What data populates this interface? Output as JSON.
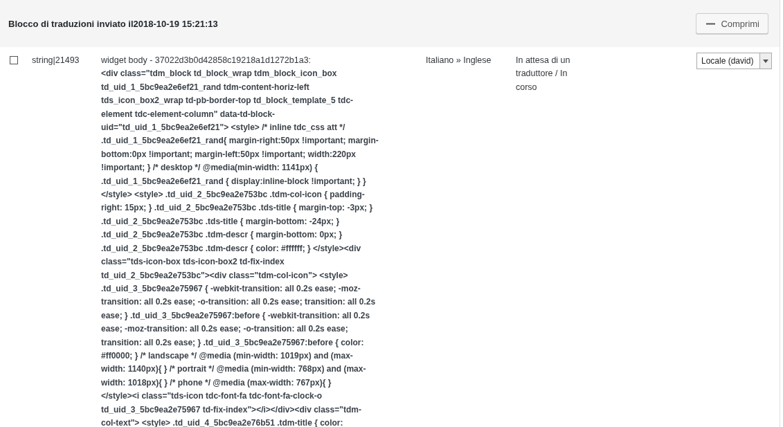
{
  "header": {
    "title": "Blocco di traduzioni inviato il2018-10-19 15:21:13",
    "collapse_button": "Comprimi"
  },
  "rows": [
    {
      "checked": false,
      "id": "string|21493",
      "title": "widget body - 37022d3b0d42858c19218a1d1272b1a3:",
      "code_lines": [
        "<div class=\"tdm_block td_block_wrap tdm_block_icon_box",
        "td_uid_1_5bc9ea2e6ef21_rand tdm-content-horiz-left",
        "tds_icon_box2_wrap td-pb-border-top td_block_template_5 tdc-",
        "element tdc-element-column\" data-td-block-",
        "uid=\"td_uid_1_5bc9ea2e6ef21\"> <style> /* inline tdc_css att */",
        ".td_uid_1_5bc9ea2e6ef21_rand{ margin-right:50px !important; margin-",
        "bottom:0px !important; margin-left:50px !important; width:220px",
        "!important; } /* desktop */ @media(min-width: 1141px) {",
        ".td_uid_1_5bc9ea2e6ef21_rand { display:inline-block !important; } }",
        "</style> <style> .td_uid_2_5bc9ea2e753bc .tdm-col-icon { padding-",
        "right: 15px; } .td_uid_2_5bc9ea2e753bc .tds-title { margin-top: -3px; }",
        ".td_uid_2_5bc9ea2e753bc .tds-title { margin-bottom: -24px; }",
        ".td_uid_2_5bc9ea2e753bc .tdm-descr { margin-bottom: 0px; }",
        ".td_uid_2_5bc9ea2e753bc .tdm-descr { color: #ffffff; } </style><div",
        "class=\"tds-icon-box tds-icon-box2 td-fix-index",
        "td_uid_2_5bc9ea2e753bc\"><div class=\"tdm-col-icon\"> <style>",
        ".td_uid_3_5bc9ea2e75967 { -webkit-transition: all 0.2s ease; -moz-",
        "transition: all 0.2s ease; -o-transition: all 0.2s ease; transition: all 0.2s",
        "ease; } .td_uid_3_5bc9ea2e75967:before { -webkit-transition: all 0.2s",
        "ease; -moz-transition: all 0.2s ease; -o-transition: all 0.2s ease;",
        "transition: all 0.2s ease; } .td_uid_3_5bc9ea2e75967:before { color:",
        "#ff0000; } /* landscape */ @media (min-width: 1019px) and (max-",
        "width: 1140px){ } /* portrait */ @media (min-width: 768px) and (max-",
        "width: 1018px){ } /* phone */ @media (max-width: 767px){ }",
        "</style><i class=\"tds-icon tdc-font-fa tdc-font-fa-clock-o",
        "td_uid_3_5bc9ea2e75967 td-fix-index\"></i></div><div class=\"tdm-",
        "col-text\"> <style> .td_uid_4_5bc9ea2e76b51 .tdm-title { color:"
      ],
      "languages": "Italiano » Inglese",
      "status": "In attesa di un traduttore / In corso",
      "translator": "Locale (david)"
    }
  ]
}
